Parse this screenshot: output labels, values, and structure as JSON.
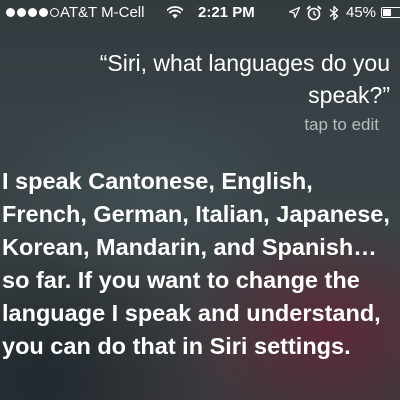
{
  "status_bar": {
    "signal_bars_total": 5,
    "signal_bars_filled": 4,
    "carrier": "AT&T M-Cell",
    "time": "2:21 PM",
    "icons": [
      "wifi-icon",
      "location-arrow-icon",
      "alarm-clock-icon",
      "bluetooth-icon",
      "battery-icon"
    ],
    "battery_percent_text": "45%",
    "battery_level": 0.45
  },
  "siri": {
    "query": "“Siri, what languages do you speak?”",
    "tap_to_edit": "tap to edit",
    "response": "I speak Cantonese, English, French, German, Italian, Japanese, Korean, Mandarin, and Spanish… so far. If you want to change the language I speak and understand, you can do that in Siri settings."
  }
}
